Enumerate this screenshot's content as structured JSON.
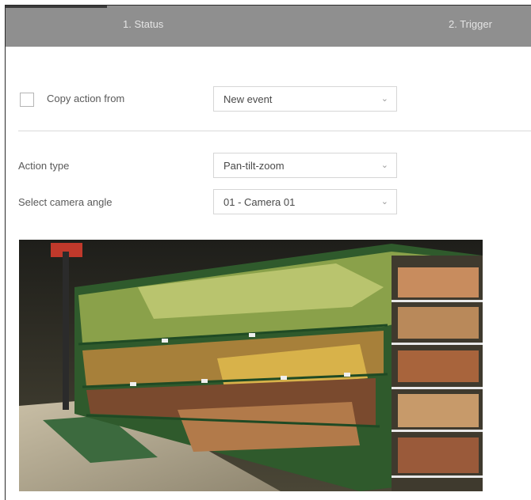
{
  "tabs": [
    {
      "label": "1. Status"
    },
    {
      "label": "2. Trigger"
    }
  ],
  "copy_action": {
    "label": "Copy action from",
    "checked": false,
    "selected": "New event"
  },
  "action_type": {
    "label": "Action type",
    "selected": "Pan-tilt-zoom"
  },
  "camera_angle": {
    "label": "Select camera angle",
    "selected": "01 - Camera 01"
  },
  "icons": {
    "dropdown": "chevron-down-icon"
  },
  "colors": {
    "tabbar": "#8f8f8f",
    "tab_text": "#e4e4e4",
    "border": "#d6d6d6"
  }
}
